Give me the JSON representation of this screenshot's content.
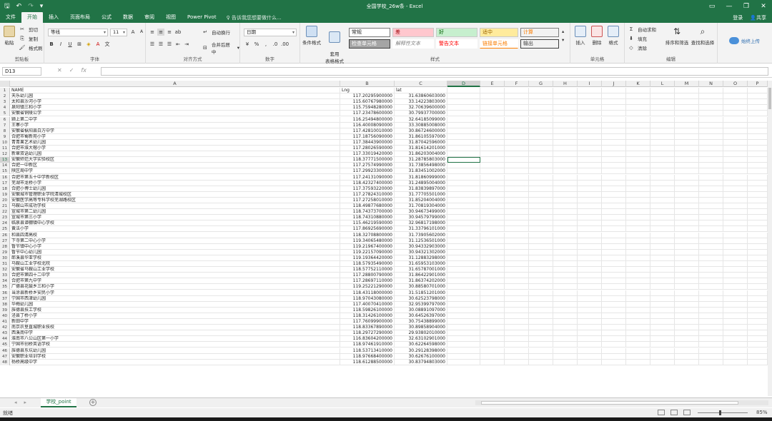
{
  "title_bar": {
    "title": "全国学校_26w条 - Excel"
  },
  "tabs": [
    "文件",
    "开始",
    "插入",
    "页面布局",
    "公式",
    "数据",
    "审阅",
    "视图",
    "Power Pivot"
  ],
  "tell_me": "告诉我您想要做什么...",
  "account": {
    "login": "登录",
    "share": "共享"
  },
  "ribbon": {
    "clipboard": {
      "label": "剪贴板",
      "paste": "粘贴",
      "cut": "剪切",
      "copy": "复制",
      "painter": "格式刷"
    },
    "font": {
      "label": "字体",
      "name": "等线",
      "size": "11"
    },
    "alignment": {
      "label": "对齐方式",
      "wrap": "自动换行",
      "merge": "合并后居中"
    },
    "number": {
      "label": "数字",
      "format": "日期"
    },
    "styles": {
      "label": "样式",
      "cond": "条件格式",
      "table": "套用\n表格格式",
      "cells": [
        "常规",
        "差",
        "好",
        "适中",
        "计算",
        "检查单元格",
        "解释性文本",
        "警告文本",
        "链接单元格",
        "输出"
      ]
    },
    "cells_grp": {
      "label": "单元格",
      "insert": "插入",
      "delete": "删除",
      "format": "格式"
    },
    "editing": {
      "label": "编辑",
      "autosum": "自动求和",
      "fill": "填充",
      "clear": "清除",
      "sort": "排序和筛选",
      "find": "查找和选择"
    },
    "upload": "始终上传"
  },
  "name_box": "D13",
  "columns": [
    "A",
    "B",
    "C",
    "D",
    "E",
    "F",
    "G",
    "H",
    "I",
    "J",
    "K",
    "L",
    "M",
    "N",
    "O",
    "P"
  ],
  "selected_cell": {
    "col": "D",
    "row": 13
  },
  "rows": [
    [
      "NAME",
      "Lng",
      "lat"
    ],
    [
      "天乐幼儿园",
      "117.20295900000",
      "31.63860603000"
    ],
    [
      "太和县沙河小学",
      "115.60767980000",
      "33.14223803000"
    ],
    [
      "泉阳镇三和小学",
      "115.75948280000",
      "32.70639600000"
    ],
    [
      "安徽省铜陵公学",
      "117.23478600000",
      "30.79937700000"
    ],
    [
      "颍上第二中学",
      "116.25494800000",
      "32.64185099000"
    ],
    [
      "王寨小学",
      "116.40008090000",
      "33.30885008000"
    ],
    [
      "安徽省枞阳县白方中学",
      "117.42810010000",
      "30.86724600000"
    ],
    [
      "合肥市蜀新苑小学",
      "117.18756090000",
      "31.86105597000"
    ],
    [
      "青青果艺术幼儿园",
      "117.38443900000",
      "31.87042596000"
    ],
    [
      "合肥市淮大榕小学",
      "117.28026590000",
      "31.81614201000"
    ],
    [
      "新章双语幼儿园",
      "117.33019420000",
      "31.86203004000"
    ],
    [
      "安徽师范大学实验校区",
      "118.37771500000",
      "31.28785803000"
    ],
    [
      "合肥一中新区",
      "117.27574990000",
      "31.73856498000"
    ],
    [
      "陕区局中学",
      "117.29923300000",
      "31.83451002000"
    ],
    [
      "合肥市第五十中学新校区",
      "117.24131090000",
      "31.81860999000"
    ],
    [
      "芜湖市龙桥小学",
      "118.42327400000",
      "31.24895004000"
    ],
    [
      "合肥小博士幼儿园",
      "117.37593220000",
      "31.83839897000"
    ],
    [
      "安徽城市管理职业学院清城校区",
      "117.27824310000",
      "31.77705501000"
    ],
    [
      "安徽医学高等专科学校芜湖路校区",
      "117.27258010000",
      "31.85204004000"
    ],
    [
      "马鞍山市成功学校",
      "118.49877680000",
      "31.70819304000"
    ],
    [
      "宣城市第二幼儿园",
      "118.74373700000",
      "30.94673499000"
    ],
    [
      "宣城市第三小学",
      "118.74310880000",
      "30.94579799000"
    ],
    [
      "临泉县谭棚镇中心学校",
      "115.46219590000",
      "32.96817198000"
    ],
    [
      "黄法小学",
      "117.86925690000",
      "31.33796101000"
    ],
    [
      "和县四清高校",
      "118.32708800000",
      "31.73905602000"
    ],
    [
      "下寺第二中心小学",
      "119.34065480000",
      "31.12536501000"
    ],
    [
      "暂节镇中心小学",
      "119.21967400000",
      "30.94332903000"
    ],
    [
      "暂节中心幼儿园",
      "119.22157090000",
      "30.94321302000"
    ],
    [
      "郎溪县华亚学校",
      "119.19364420000",
      "31.12883298000"
    ],
    [
      "马鞍山工业学校北院",
      "118.57935490000",
      "31.65953103000"
    ],
    [
      "安徽省马鞍山工业学校",
      "118.57752110000",
      "31.65787001000"
    ],
    [
      "合肥市第四十二中学",
      "117.28800790000",
      "31.86422901000"
    ],
    [
      "合肥市第九中学",
      "117.28697110000",
      "31.86374202000"
    ],
    [
      "广德县花鼓乡三和小学",
      "119.25221290000",
      "30.88580701000"
    ],
    [
      "当涂县新桥乡安民小学",
      "118.43118000000",
      "31.51851201000"
    ],
    [
      "宁国市西津幼儿园",
      "118.97043080000",
      "30.62523798000"
    ],
    [
      "华梅幼儿园",
      "117.40070410000",
      "32.95399797000"
    ],
    [
      "旌德县技工学校",
      "118.59826100000",
      "30.08891097000"
    ],
    [
      "泾县丁桥小学",
      "118.31426100000",
      "30.64526397000"
    ],
    [
      "新田中学",
      "117.76099900000",
      "30.75438899000"
    ],
    [
      "南京农垦直城职业技校",
      "118.83367890000",
      "30.89858904000"
    ],
    [
      "西溪南中学",
      "118.29727290000",
      "29.93802010000"
    ],
    [
      "淮南市八公山区第一小学",
      "116.83604200000",
      "32.63102901000"
    ],
    [
      "宁国市创桥英语学校",
      "118.97461910000",
      "30.62264598000"
    ],
    [
      "旌德县东坑幼儿园",
      "118.53713410000",
      "30.29128398000"
    ],
    [
      "安徽职业培训学校",
      "118.97668400000",
      "30.62676100000"
    ],
    [
      "杨桥高级中学",
      "118.61288500000",
      "30.83794803000"
    ]
  ],
  "sheet_tab": "学校_point",
  "status": {
    "ready": "就绪",
    "zoom": "85%"
  }
}
